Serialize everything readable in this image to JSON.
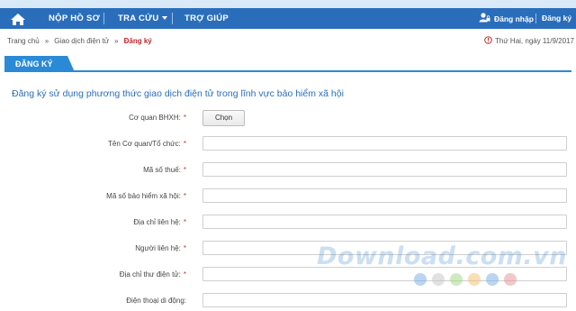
{
  "nav": {
    "items": [
      {
        "label": "NỘP HỒ SƠ"
      },
      {
        "label": "TRA CỨU"
      },
      {
        "label": "TRỢ GIÚP"
      }
    ],
    "login_label": "Đăng nhập",
    "register_label": "Đăng ký"
  },
  "breadcrumb": {
    "home": "Trang chủ",
    "parent": "Giao dịch điện tử",
    "current": "Đăng ký",
    "separator": "»"
  },
  "date_text": "Thứ Hai, ngày 11/9/2017",
  "tab_label": "ĐĂNG KÝ",
  "form": {
    "title": "Đăng ký sử dụng phương thức giao dịch điện tử trong lĩnh vực bảo hiểm xã hội",
    "choose_button": "Chọn",
    "required_mark": "*",
    "fields": [
      {
        "label": "Cơ quan BHXH:",
        "required": true
      },
      {
        "label": "Tên Cơ quan/Tổ chức:",
        "required": true,
        "value": ""
      },
      {
        "label": "Mã số thuế:",
        "required": true,
        "value": ""
      },
      {
        "label": "Mã số bảo hiểm xã hội:",
        "required": true,
        "value": ""
      },
      {
        "label": "Địa chỉ liên hệ:",
        "required": true,
        "value": ""
      },
      {
        "label": "Người liên hệ:",
        "required": true,
        "value": ""
      },
      {
        "label": "Địa chỉ thư điện tử:",
        "required": true,
        "value": ""
      },
      {
        "label": "Điện thoại di động:",
        "required": false,
        "value": ""
      }
    ]
  },
  "watermark_text": "Download.com.vn",
  "colors": {
    "nav_bg": "#2a6ebb",
    "tab_bg": "#2a8ad6",
    "title": "#2a6ebb",
    "breadcrumb_current": "#c0282e",
    "required": "#d9302b"
  },
  "icons": {
    "home": "home-icon",
    "login": "user-lock-icon",
    "date": "clock-alert-icon",
    "tra_cuu_dropdown": "caret-down-icon"
  }
}
